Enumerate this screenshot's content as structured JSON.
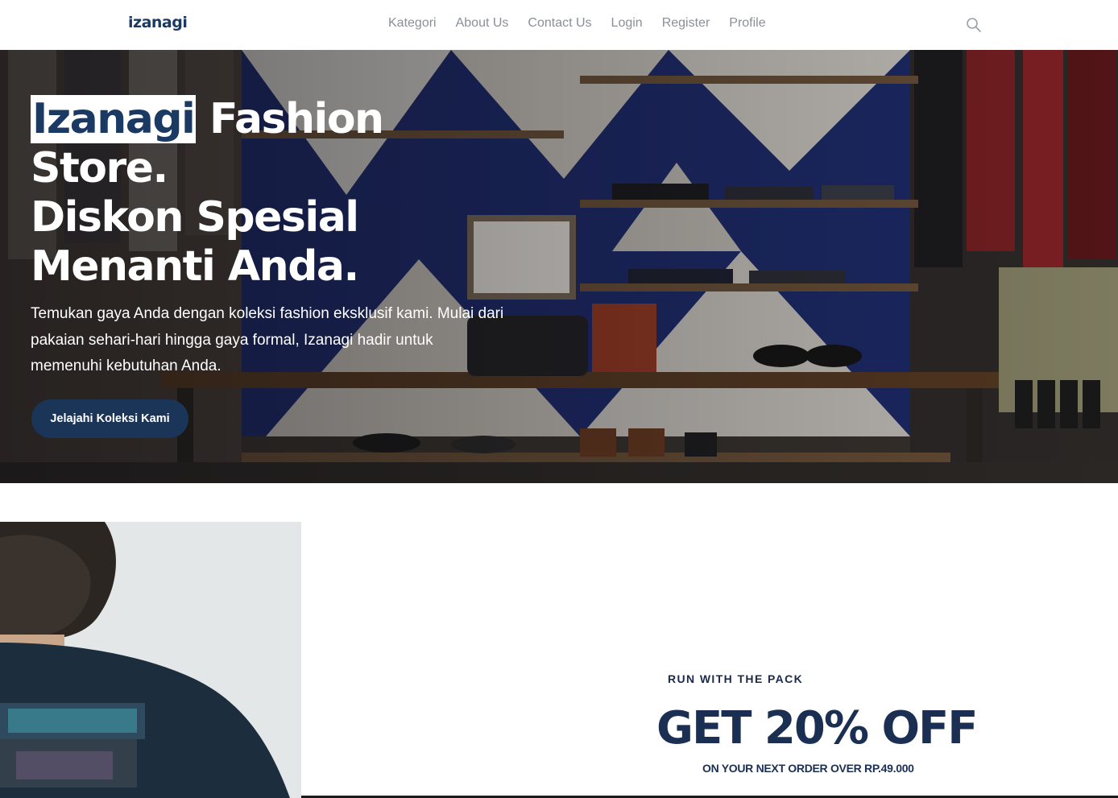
{
  "header": {
    "logo": "izanagi",
    "nav": [
      "Kategori",
      "About Us",
      "Contact Us",
      "Login",
      "Register",
      "Profile"
    ],
    "search_icon": "search-icon"
  },
  "hero": {
    "title_brand": "Izanagi",
    "title_rest_1": " Fashion",
    "title_line_2": "Store.",
    "title_line_3": "Diskon Spesial",
    "title_line_4": "Menanti Anda.",
    "description": "Temukan gaya Anda dengan koleksi fashion eksklusif kami. Mulai dari pakaian sehari-hari hingga gaya formal, Izanagi hadir untuk memenuhi kebutuhan Anda.",
    "cta_label": "Jelajahi Koleksi Kami"
  },
  "promo": {
    "tagline": "RUN WITH THE PACK",
    "headline": "GET 20% OFF",
    "subline": "ON YOUR NEXT ORDER OVER RP.49.000"
  },
  "colors": {
    "brand_navy": "#1b3558",
    "nav_text": "#8a8f98",
    "headline": "#1b2f52"
  }
}
